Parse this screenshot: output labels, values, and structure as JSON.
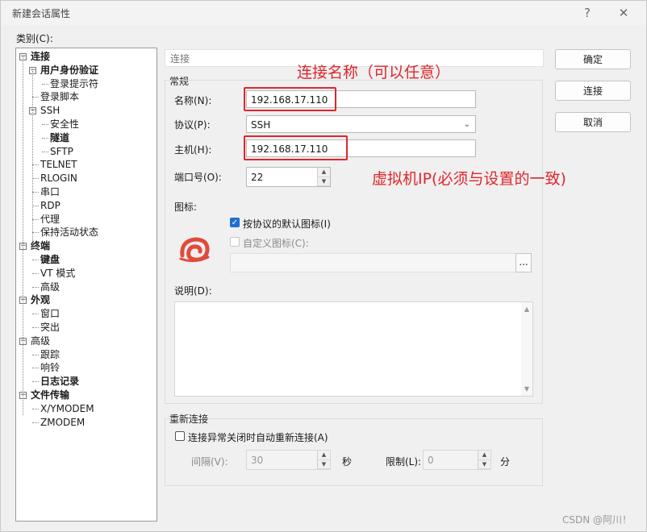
{
  "window": {
    "title": "新建会话属性",
    "help_glyph": "?",
    "close_glyph": "✕"
  },
  "category_label": "类别(C):",
  "tree": [
    {
      "label": "连接",
      "bold": true,
      "toggle": "⊟"
    },
    {
      "label": "用户身份验证",
      "bold": true,
      "toggle": "⊟"
    },
    {
      "label": "登录提示符",
      "bold": false
    },
    {
      "label": "登录脚本",
      "bold": false
    },
    {
      "label": "SSH",
      "bold": false,
      "toggle": "⊟"
    },
    {
      "label": "安全性",
      "bold": false
    },
    {
      "label": "隧道",
      "bold": true
    },
    {
      "label": "SFTP",
      "bold": false
    },
    {
      "label": "TELNET",
      "bold": false
    },
    {
      "label": "RLOGIN",
      "bold": false
    },
    {
      "label": "串口",
      "bold": false
    },
    {
      "label": "RDP",
      "bold": false
    },
    {
      "label": "代理",
      "bold": false
    },
    {
      "label": "保持活动状态",
      "bold": false
    },
    {
      "label": "终端",
      "bold": true,
      "toggle": "⊟"
    },
    {
      "label": "键盘",
      "bold": true
    },
    {
      "label": "VT 模式",
      "bold": false
    },
    {
      "label": "高级",
      "bold": false
    },
    {
      "label": "外观",
      "bold": true,
      "toggle": "⊟"
    },
    {
      "label": "窗口",
      "bold": false
    },
    {
      "label": "突出",
      "bold": false
    },
    {
      "label": "高级",
      "bold": false,
      "toggle": "⊟"
    },
    {
      "label": "跟踪",
      "bold": false
    },
    {
      "label": "响铃",
      "bold": false
    },
    {
      "label": "日志记录",
      "bold": true
    },
    {
      "label": "文件传输",
      "bold": true,
      "toggle": "⊟"
    },
    {
      "label": "X/YMODEM",
      "bold": false
    },
    {
      "label": "ZMODEM",
      "bold": false
    }
  ],
  "breadcrumb": "连接",
  "general": {
    "title": "常规",
    "name_label": "名称(N):",
    "name_value": "192.168.17.110",
    "protocol_label": "协议(P):",
    "protocol_value": "SSH",
    "host_label": "主机(H):",
    "host_value": "192.168.17.110",
    "port_label": "端口号(O):",
    "port_value": "22",
    "icon_label": "图标:",
    "default_icon_checkbox": "按协议的默认图标(I)",
    "default_icon_checked": true,
    "custom_icon_checkbox": "自定义图标(C):",
    "custom_icon_checked": false,
    "browse_label": "...",
    "description_label": "说明(D):"
  },
  "reconnect": {
    "title": "重新连接",
    "auto_checkbox": "连接异常关闭时自动重新连接(A)",
    "auto_checked": false,
    "interval_label": "间隔(V):",
    "interval_value": "30",
    "interval_unit": "秒",
    "limit_label": "限制(L):",
    "limit_value": "0",
    "limit_unit": "分"
  },
  "buttons": {
    "ok": "确定",
    "connect": "连接",
    "cancel": "取消"
  },
  "annotations": {
    "name_note": "连接名称（可以任意）",
    "host_note": "虚拟机IP(必须与设置的一致)"
  },
  "watermark": "CSDN @阿川！",
  "colors": {
    "annotation_red": "#e0262d",
    "checkbox_blue": "#1f6fd1",
    "icon_red": "#e24a3b"
  },
  "icons": {
    "session_icon": "spiral-shell-icon"
  }
}
